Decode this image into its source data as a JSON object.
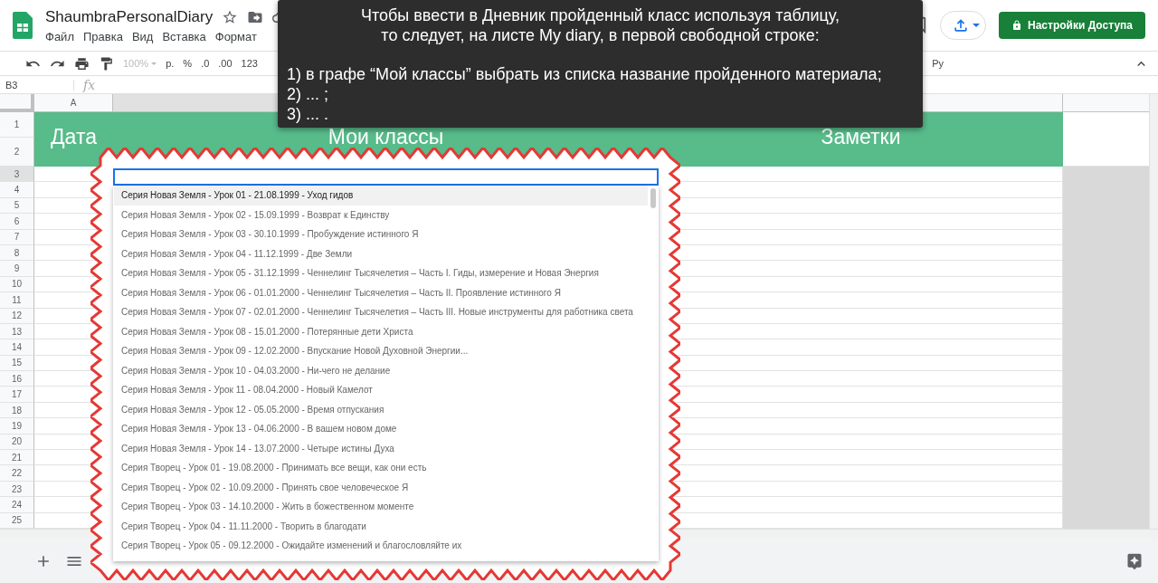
{
  "app": {
    "title": "ShaumbraPersonalDiary",
    "menu": [
      "Файл",
      "Правка",
      "Вид",
      "Вставка",
      "Формат"
    ],
    "share_button": "Настройки Доступа"
  },
  "toolbar": {
    "zoom": "100%",
    "currency": "р.",
    "percent": "%",
    "decrease_decimals": ".0",
    "increase_decimals": ".00",
    "number_format": "123",
    "input_tools": "Ру"
  },
  "formula_bar": {
    "cell_ref": "B3",
    "fx": "fx"
  },
  "columns": [
    "A"
  ],
  "header": {
    "row_numbers": [
      "1",
      "2"
    ],
    "cells": [
      "Дата",
      "Мои классы",
      "Заметки"
    ]
  },
  "rows": [
    {
      "number": "3",
      "selected": true
    },
    {
      "number": "4",
      "selected": false
    },
    {
      "number": "5",
      "selected": false
    },
    {
      "number": "6",
      "selected": false
    },
    {
      "number": "7",
      "selected": false
    },
    {
      "number": "8",
      "selected": false
    },
    {
      "number": "9",
      "selected": false
    },
    {
      "number": "10",
      "selected": false
    },
    {
      "number": "11",
      "selected": false
    },
    {
      "number": "12",
      "selected": false
    },
    {
      "number": "13",
      "selected": false
    },
    {
      "number": "14",
      "selected": false
    },
    {
      "number": "15",
      "selected": false
    },
    {
      "number": "16",
      "selected": false
    },
    {
      "number": "17",
      "selected": false
    },
    {
      "number": "18",
      "selected": false
    },
    {
      "number": "19",
      "selected": false
    },
    {
      "number": "20",
      "selected": false
    },
    {
      "number": "21",
      "selected": false
    },
    {
      "number": "22",
      "selected": false
    },
    {
      "number": "23",
      "selected": false
    },
    {
      "number": "24",
      "selected": false
    },
    {
      "number": "25",
      "selected": false
    }
  ],
  "dropdown": {
    "items": [
      {
        "label": "Серия Новая Земля - Урок 01 - 21.08.1999 - Уход гидов",
        "selected": true
      },
      {
        "label": "Серия Новая Земля - Урок 02 - 15.09.1999 - Возврат к Единству",
        "selected": false
      },
      {
        "label": "Серия Новая Земля - Урок 03 - 30.10.1999 - Пробуждение истинного Я",
        "selected": false
      },
      {
        "label": "Серия Новая Земля - Урок 04 - 11.12.1999 - Две Земли",
        "selected": false
      },
      {
        "label": "Серия Новая Земля - Урок 05 - 31.12.1999 - Ченнелинг Тысячелетия – Часть I. Гиды, измерение и Новая Энергия",
        "selected": false
      },
      {
        "label": "Серия Новая Земля - Урок 06 - 01.01.2000 - Ченнелинг Тысячелетия – Часть II. Проявление истинного Я",
        "selected": false
      },
      {
        "label": "Серия Новая Земля - Урок 07 - 02.01.2000 - Ченнелинг Тысячелетия – Часть III. Новые инструменты для работника света",
        "selected": false
      },
      {
        "label": "Серия Новая Земля - Урок 08 - 15.01.2000 - Потерянные дети Христа",
        "selected": false
      },
      {
        "label": "Серия Новая Земля - Урок 09 - 12.02.2000 - Впускание Новой Духовной Энергии...",
        "selected": false
      },
      {
        "label": "Серия Новая Земля - Урок 10 - 04.03.2000 - Ни-чего не делание",
        "selected": false
      },
      {
        "label": "Серия Новая Земля - Урок 11 - 08.04.2000 - Новый Камелот",
        "selected": false
      },
      {
        "label": "Серия Новая Земля - Урок 12 - 05.05.2000 - Время отпускания",
        "selected": false
      },
      {
        "label": "Серия Новая Земля - Урок 13 - 04.06.2000 - В вашем новом доме",
        "selected": false
      },
      {
        "label": "Серия Новая Земля - Урок 14 - 13.07.2000 - Четыре истины Духа",
        "selected": false
      },
      {
        "label": "Серия Творец - Урок 01 - 19.08.2000 - Принимать все вещи, как они есть",
        "selected": false
      },
      {
        "label": "Серия Творец - Урок 02 - 10.09.2000 - Принять свое человеческое Я",
        "selected": false
      },
      {
        "label": "Серия Творец - Урок 03 - 14.10.2000 - Жить в божественном моменте",
        "selected": false
      },
      {
        "label": "Серия Творец - Урок 04 - 11.11.2000 - Творить в благодати",
        "selected": false
      },
      {
        "label": "Серия Творец - Урок 05 - 09.12.2000 - Ожидайте изменений и благословляйте их",
        "selected": false
      }
    ]
  },
  "tooltip": {
    "intro": [
      "Чтобы ввести в Дневник пройденный класс используя таблицу,",
      "то следует, на листе My diary, в первой свободной строке:"
    ],
    "steps": [
      "1) в графе “Мой классы” выбрать из списка название пройденного материала;",
      "2) ... ;",
      "3) ... ."
    ]
  }
}
